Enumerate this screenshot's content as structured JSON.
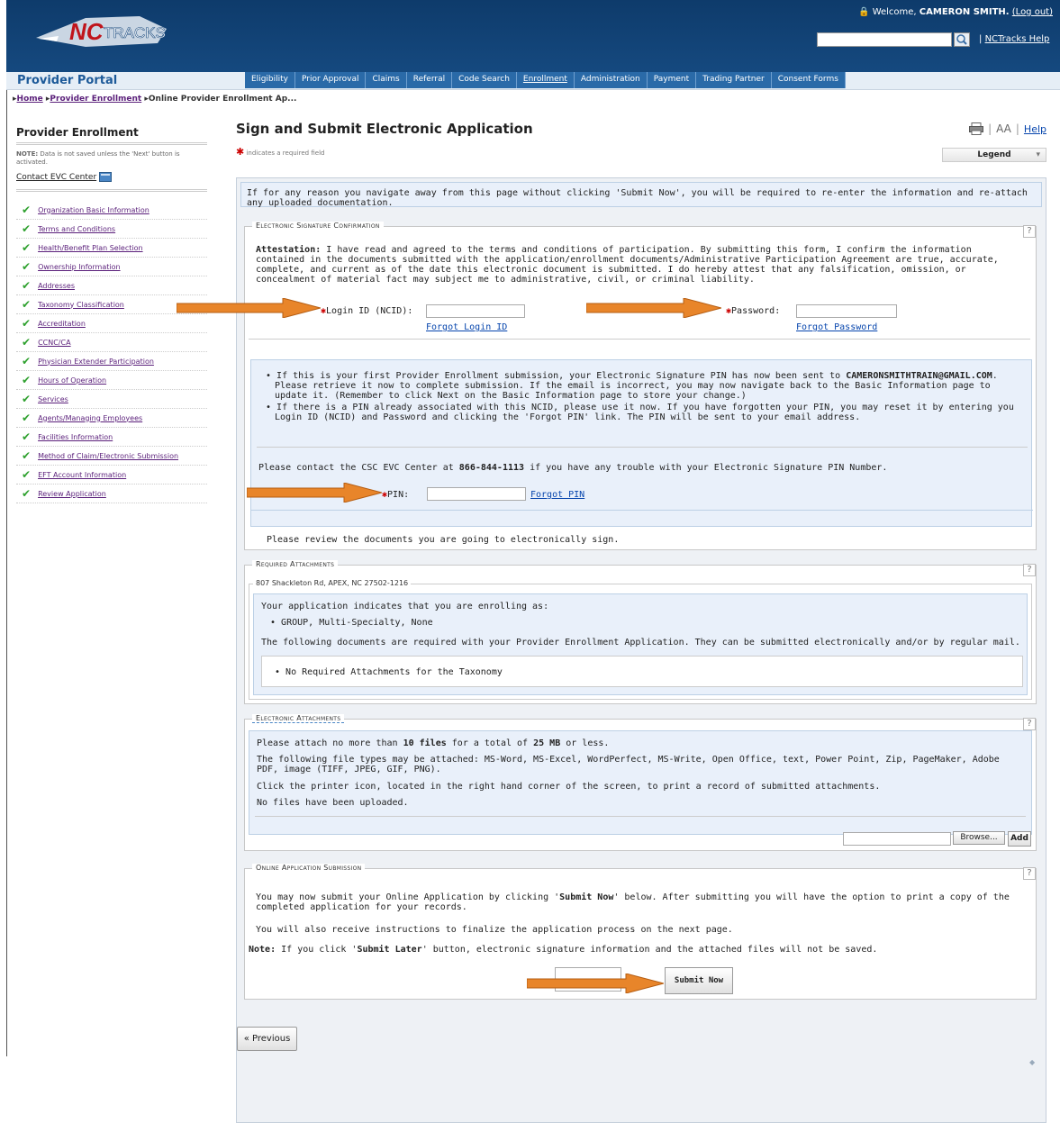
{
  "header": {
    "logo_text": "NC TRACKS",
    "welcome_prefix": "Welcome,",
    "user_name": "CAMERON SMITH.",
    "logout": "(Log out)",
    "help": "NCTracks Help",
    "help_sep": "|"
  },
  "portal": {
    "title": "Provider Portal"
  },
  "nav": [
    "Eligibility",
    "Prior Approval",
    "Claims",
    "Referral",
    "Code Search",
    "Enrollment",
    "Administration",
    "Payment",
    "Trading Partner",
    "Consent Forms"
  ],
  "breadcrumb": {
    "home": "Home",
    "enrollment": "Provider Enrollment",
    "current": "Online Provider Enrollment Ap..."
  },
  "sidebar": {
    "title": "Provider Enrollment",
    "note_bold": "NOTE:",
    "note": "Data is not saved unless the 'Next' button is activated.",
    "contact": "Contact EVC Center",
    "items": [
      "Organization Basic Information",
      "Terms and Conditions",
      "Health/Benefit Plan Selection",
      "Ownership Information",
      "Addresses",
      "Taxonomy Classification",
      "Accreditation",
      "CCNC/CA",
      "Physician Extender Participation",
      "Hours of Operation",
      "Services",
      "Agents/Managing Employees",
      "Facilities Information",
      "Method of Claim/Electronic Submission",
      "EFT Account Information",
      "Review Application"
    ]
  },
  "main": {
    "title": "Sign and Submit Electronic Application",
    "tools_aa": "AA",
    "tools_sep": "|",
    "help": "Help",
    "required_note": "indicates a required field",
    "legend": "Legend",
    "navigate_warning": "If for any reason you navigate away from this page without clicking 'Submit Now', you will be required to re-enter the information and re-attach any uploaded documentation."
  },
  "esig": {
    "legend": "Electronic Signature Confirmation",
    "attest_bold": "Attestation:",
    "attest": "I have read and agreed to the terms and conditions of participation. By submitting this form, I confirm the information contained in the documents submitted with the application/enrollment documents/Administrative Participation Agreement are true, accurate, complete, and current as of the date this electronic document is submitted. I do hereby attest that any falsification, omission, or concealment of material fact may subject me to administrative, civil, or criminal liability.",
    "login_label": "Login ID (NCID):",
    "forgot_login": "Forgot Login ID",
    "password_label": "Password:",
    "forgot_password": "Forgot Password",
    "pin_bullet1_a": "If this is your first Provider Enrollment submission, your Electronic Signature PIN has now been sent to",
    "pin_email": "CAMERONSMITHTRAIN@GMAIL.COM",
    "pin_bullet1_b": ". Please retrieve it now to complete submission. If the email is incorrect, you may now navigate back to the Basic Information page to update it. (Remember to click Next on the Basic Information page to store your change.)",
    "pin_bullet2": "If there is a PIN already associated with this NCID, please use it now. If you have forgotten your PIN, you may reset it by entering you Login ID (NCID) and Password and clicking the 'Forgot PIN' link. The PIN will be sent to your email address.",
    "contact_a": "Please contact the CSC EVC Center at",
    "contact_phone": "866-844-1113",
    "contact_b": "if you have any trouble with your Electronic Signature PIN Number.",
    "pin_label": "PIN:",
    "forgot_pin": "Forgot PIN",
    "review": "Please review the documents you are going to electronically sign."
  },
  "attach": {
    "legend": "Required Attachments",
    "address": "807 Shackleton Rd, APEX, NC 27502-1216",
    "enrolling_as": "Your application indicates that you are enrolling as:",
    "type": "GROUP, Multi-Specialty, None",
    "following": "The following documents are required with your Provider Enrollment Application. They can be submitted electronically and/or by regular mail.",
    "none": "No Required Attachments for the Taxonomy"
  },
  "eattach": {
    "legend": "Electronic Attachments",
    "limit_a": "Please attach no more than",
    "limit_files": "10 files",
    "limit_b": "for a total of",
    "limit_size": "25 MB",
    "limit_c": "or less.",
    "types": "The following file types may be attached: MS-Word, MS-Excel, WordPerfect, MS-Write, Open Office, text, Power Point, Zip, PageMaker, Adobe PDF, image (TIFF, JPEG, GIF, PNG).",
    "printer": "Click the printer icon, located in the right hand corner of the screen, to print a record of submitted attachments.",
    "nofiles": "No files have been uploaded.",
    "browse": "Browse...",
    "add": "Add"
  },
  "submit": {
    "legend": "Online Application Submission",
    "p1_a": "You may now submit your Online Application by clicking '",
    "p1_bold": "Submit Now",
    "p1_b": "' below. After submitting you will have the option to print a copy of the completed application for your records.",
    "p2": "You will also receive instructions to finalize the application process on the next page.",
    "note_bold": "Note:",
    "note_a": "If you click '",
    "note_btn": "Submit Later",
    "note_b": "' button, electronic signature information and the attached files will not be saved.",
    "submit_now": "Submit Now"
  },
  "footer": {
    "previous": "« Previous"
  }
}
